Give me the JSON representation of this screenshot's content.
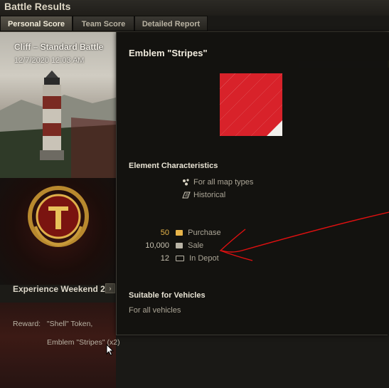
{
  "window": {
    "title": "Battle Results"
  },
  "tabs": [
    {
      "label": "Personal Score",
      "active": true
    },
    {
      "label": "Team Score",
      "active": false
    },
    {
      "label": "Detailed Report",
      "active": false
    }
  ],
  "battle": {
    "title": "Cliff – Standard Battle",
    "datetime": "12/7/2020 12:03 AM"
  },
  "event": {
    "name": "Experience Weekend 2",
    "reward_label": "Reward:",
    "reward_line1": "\"Shell\" Token,",
    "reward_line2": "Emblem \"Stripes\" (x2)"
  },
  "tooltip": {
    "title": "Emblem \"Stripes\"",
    "characteristics_heading": "Element Characteristics",
    "characteristics": [
      {
        "icon": "map-types-icon",
        "label": "For all map types"
      },
      {
        "icon": "historical-icon",
        "label": "Historical"
      }
    ],
    "prices": [
      {
        "value": "50",
        "icon": "gold-icon",
        "label": "Purchase"
      },
      {
        "value": "10,000",
        "icon": "credits-icon",
        "label": "Sale"
      },
      {
        "value": "12",
        "icon": "depot-icon",
        "label": "In Depot"
      }
    ],
    "vehicles_heading": "Suitable for Vehicles",
    "vehicles_text": "For all vehicles"
  },
  "colors": {
    "gold": "#e8b54a",
    "emblem_red": "#d8222a",
    "annotation_red": "#e01010"
  }
}
